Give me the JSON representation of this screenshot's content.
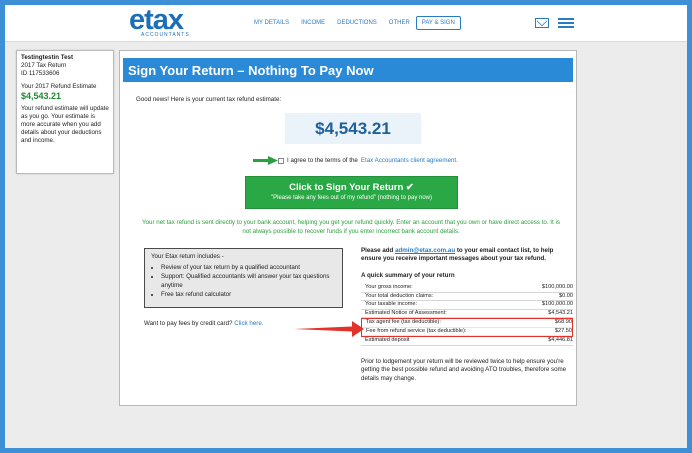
{
  "brand": {
    "name": "etax",
    "sub": "ACCOUNTANTS",
    "color": "#1c6fb7"
  },
  "nav": [
    {
      "label": "MY DETAILS"
    },
    {
      "label": "INCOME"
    },
    {
      "label": "DEDUCTIONS"
    },
    {
      "label": "OTHER"
    },
    {
      "label": "PAY & SIGN"
    }
  ],
  "icons": {
    "mail": "mail-icon",
    "menu": "menu-icon"
  },
  "sidebar": {
    "name": "Testingtestin Test",
    "year": "2017 Tax Return",
    "id": "ID 117533606",
    "estimate_label": "Your 2017 Refund Estimate",
    "estimate_amount": "$4,543.21",
    "note": "Your refund estimate will update as you go. Your estimate is more accurate when you add details about your deductions and income."
  },
  "main": {
    "title": "Sign Your Return – Nothing To Pay Now",
    "intro": "Good news! Here is your current tax refund estimate:",
    "amount": "$4,543.21",
    "agree_text": "I agree to the terms of the",
    "agree_link": "Etax Accountants client agreement.",
    "sign_button": "Click to Sign Your Return ✔",
    "sign_sub": "\"Please take any fees out of my refund\" (nothing to pay now)",
    "notice": "Your net tax refund is sent directly to your bank account, helping you get your refund quickly. Enter an account that you own or have direct access to. It is not always possible to recover funds if you enter incorrect bank account details.",
    "includes_title": "Your Etax return includes -",
    "includes": [
      "Review of your tax return by a qualified accountant",
      "Support: Qualified accountants will answer your tax questions anytime",
      "Free tax refund calculator"
    ],
    "cc_text": "Want to pay fees by credit card?",
    "cc_link": "Click here.",
    "email_before": "Please add",
    "email_link": "admin@etax.com.au",
    "email_after": "to your email contact list, to help ensure you receive important messages about your tax refund.",
    "summary_title": "A quick summary of your return",
    "rows_before": [
      {
        "label": "Your gross income:",
        "value": "$100,000.00"
      },
      {
        "label": "Your total deduction claims:",
        "value": "$0.00"
      },
      {
        "label": "Your taxable income:",
        "value": "$100,000.00"
      },
      {
        "label": "Estimated Notice of Assessment:",
        "value": "$4,543.21"
      }
    ],
    "rows_highlight": [
      {
        "label": "Tax agent fee (tax deductible):",
        "value": "$68.90"
      },
      {
        "label": "Fee from refund service (tax deductible):",
        "value": "$27.50"
      }
    ],
    "rows_after": [
      {
        "label": "Estimated deposit",
        "value": "$4,446.81"
      }
    ],
    "lodge_note": "Prior to lodgement your return will be reviewed twice to help ensure you're getting the best possible refund and avoiding ATO troubles, therefore some details may change."
  },
  "colors": {
    "accent": "#2b8ad8",
    "green": "#2aa845",
    "highlight": "#e2322a",
    "background": "#3d8fd6"
  }
}
